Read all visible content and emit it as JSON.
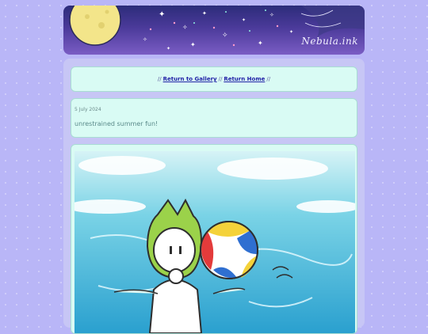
{
  "banner": {
    "signature": "Nebula.ink"
  },
  "nav": {
    "prefix": "//",
    "gallery_label": "Return to Gallery",
    "separator": "//",
    "home_label": "Return Home",
    "suffix": "//"
  },
  "post": {
    "date": "5 July 2024",
    "title": "unrestrained summer fun!"
  },
  "colors": {
    "page_bg": "#b9b6f7",
    "card_bg": "#d9fbf4",
    "link": "#2323a8"
  }
}
